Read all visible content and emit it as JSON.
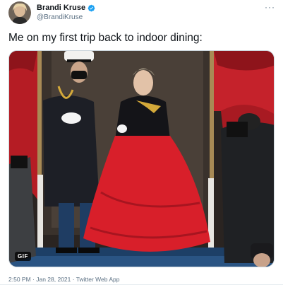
{
  "author": {
    "name": "Brandi Kruse",
    "handle": "@BrandiKruse",
    "verified": true
  },
  "more_menu": "···",
  "tweet_text": "Me on my first trip back to indoor dining:",
  "media": {
    "badge": "GIF"
  },
  "meta": {
    "time": "2:50 PM",
    "separator1": " · ",
    "date": "Jan 28, 2021",
    "separator2": " · ",
    "source": "Twitter Web App"
  },
  "colors": {
    "verified_blue": "#1da1f2",
    "secondary_text": "#5b7083",
    "dress_red": "#d81f2a"
  }
}
